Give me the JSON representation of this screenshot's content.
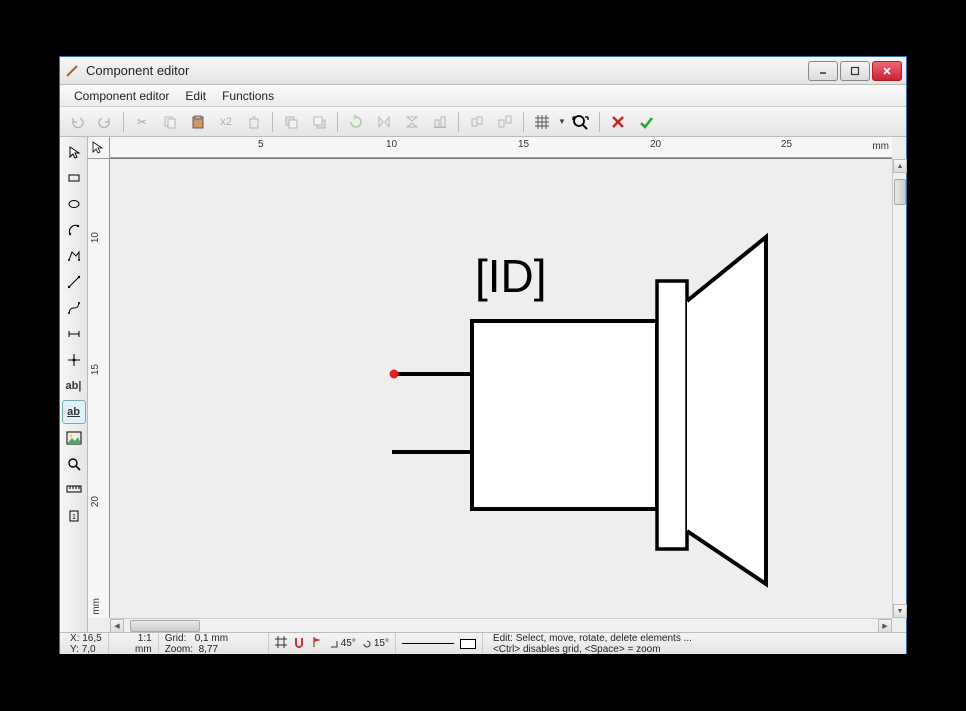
{
  "window": {
    "title": "Component editor"
  },
  "menubar": {
    "items": [
      "Component editor",
      "Edit",
      "Functions"
    ]
  },
  "toolbar": {
    "x2_label": "x2"
  },
  "ruler": {
    "unit": "mm",
    "h_ticks": [
      "5",
      "10",
      "15",
      "20",
      "25"
    ],
    "v_ticks": [
      "10",
      "15",
      "20"
    ]
  },
  "canvas": {
    "id_label": "[ID]"
  },
  "status": {
    "x_label": "X:",
    "x_value": "16,5",
    "y_label": "Y:",
    "y_value": "7,0",
    "ratio": "1:1",
    "ratio_unit": "mm",
    "grid_label": "Grid:",
    "grid_value": "0,1 mm",
    "zoom_label": "Zoom:",
    "zoom_value": "8,77",
    "snap_angle1": "45°",
    "snap_angle2": "15°",
    "info_line1": "Edit: Select, move, rotate, delete elements ...",
    "info_line2": "<Ctrl> disables grid, <Space> = zoom"
  }
}
